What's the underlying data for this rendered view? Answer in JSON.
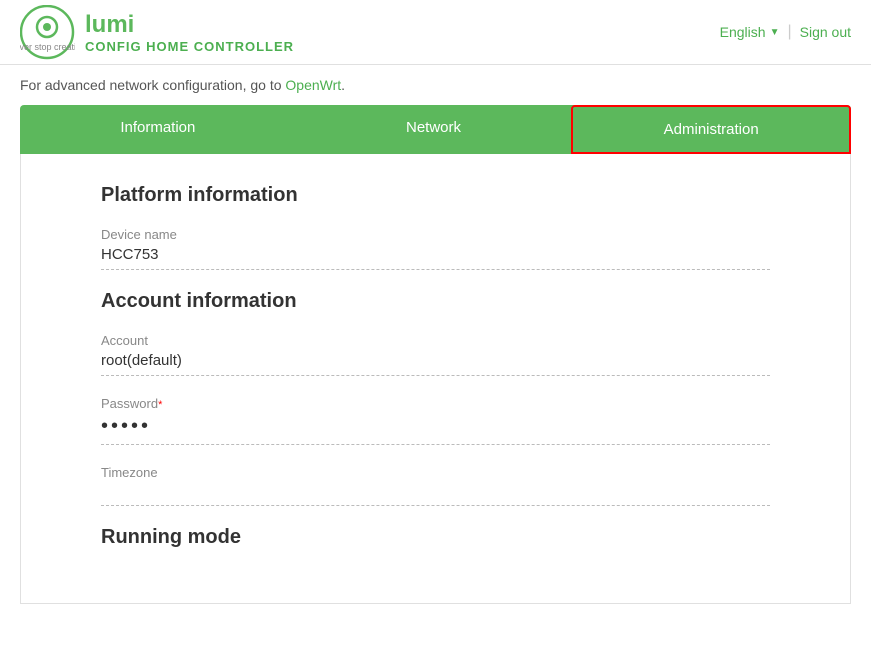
{
  "header": {
    "logo_text": "CONFIG HOME CONTROLLER",
    "language_label": "English",
    "signout_label": "Sign out"
  },
  "notice": {
    "prefix": "For advanced network configuration, go to",
    "link_text": "OpenWrt",
    "suffix": "."
  },
  "tabs": [
    {
      "id": "information",
      "label": "Information",
      "active": false
    },
    {
      "id": "network",
      "label": "Network",
      "active": false
    },
    {
      "id": "administration",
      "label": "Administration",
      "active": true
    }
  ],
  "platform": {
    "section_title": "Platform information",
    "device_name_label": "Device name",
    "device_name_value": "HCC753"
  },
  "account": {
    "section_title": "Account information",
    "account_label": "Account",
    "account_value": "root(default)",
    "password_label": "Password",
    "password_required": "*",
    "password_dots": "•••••",
    "timezone_label": "Timezone",
    "timezone_value": ""
  },
  "running": {
    "section_title": "Running mode"
  }
}
